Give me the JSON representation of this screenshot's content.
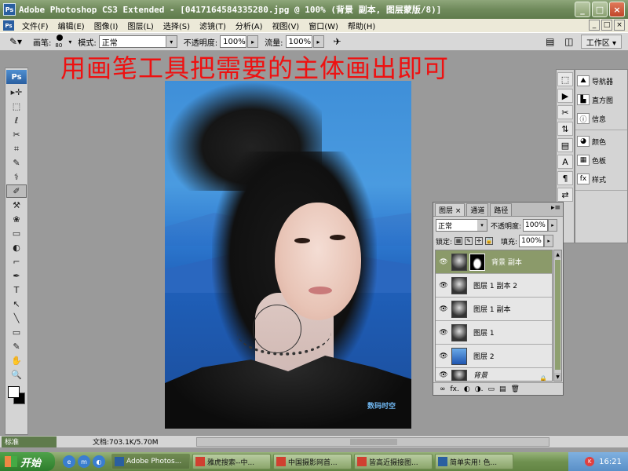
{
  "window": {
    "app_icon": "Ps",
    "title": "Adobe Photoshop CS3 Extended - [0417164584335280.jpg @ 100% (背景 副本, 图层蒙版/8)]",
    "min_glyph": "_",
    "max_glyph": "□",
    "close_glyph": "×"
  },
  "menubar": {
    "items": [
      "文件(F)",
      "编辑(E)",
      "图像(I)",
      "图层(L)",
      "选择(S)",
      "滤镜(T)",
      "分析(A)",
      "视图(V)",
      "窗口(W)",
      "帮助(H)"
    ]
  },
  "options": {
    "brush_label": "画笔:",
    "brush_size": "80",
    "mode_label": "模式:",
    "mode_value": "正常",
    "opacity_label": "不透明度:",
    "opacity_value": "100%",
    "flow_label": "流量:",
    "flow_value": "100%",
    "workspace_label": "工作区 ▾"
  },
  "instruction_text": "用画笔工具把需要的主体画出即可",
  "toolbox": {
    "logo": "Ps",
    "tools": [
      "▸✛",
      "⬚",
      "ℓ",
      "✂",
      "⌗",
      "✎",
      "⚕",
      "✐",
      "⚒",
      "❀",
      "▭",
      "◐",
      "⌐",
      "✒",
      "T",
      "↖",
      "╲",
      "▭",
      "✎",
      "✋",
      "🔍"
    ]
  },
  "dock": {
    "icons": [
      "⬚",
      "▶",
      "✂",
      "⇅",
      "▤",
      "A",
      "¶",
      "⇄"
    ],
    "items": [
      "导航器",
      "直方图",
      "信息",
      "颜色",
      "色板",
      "样式"
    ]
  },
  "layers_panel": {
    "tabs": [
      "图层 ×",
      "通道",
      "路径"
    ],
    "menu_glyph": "▸≡",
    "blend_mode": "正常",
    "opacity_label": "不透明度:",
    "opacity_value": "100%",
    "lock_label": "锁定:",
    "fill_label": "填充:",
    "fill_value": "100%",
    "layers": [
      {
        "name": "背景 副本"
      },
      {
        "name": "图层 1 副本 2"
      },
      {
        "name": "图层 1 副本"
      },
      {
        "name": "图层 1"
      },
      {
        "name": "图层 2"
      },
      {
        "name": "背景"
      }
    ],
    "footer_icons": [
      "∞",
      "fx.",
      "◐",
      "◑.",
      "▭",
      "▤",
      "🗑"
    ]
  },
  "status": {
    "zoom": "标准",
    "doc_info": "文档:703.1K/5.70M"
  },
  "watermark": "数码时空",
  "taskbar": {
    "start_label": "开始",
    "tasks": [
      "Adobe Photos...",
      "雅虎搜索--中...",
      "中国摄影网首...",
      "皆高近摄接图...",
      "简单实用! 色..."
    ],
    "clock": "16:21"
  }
}
